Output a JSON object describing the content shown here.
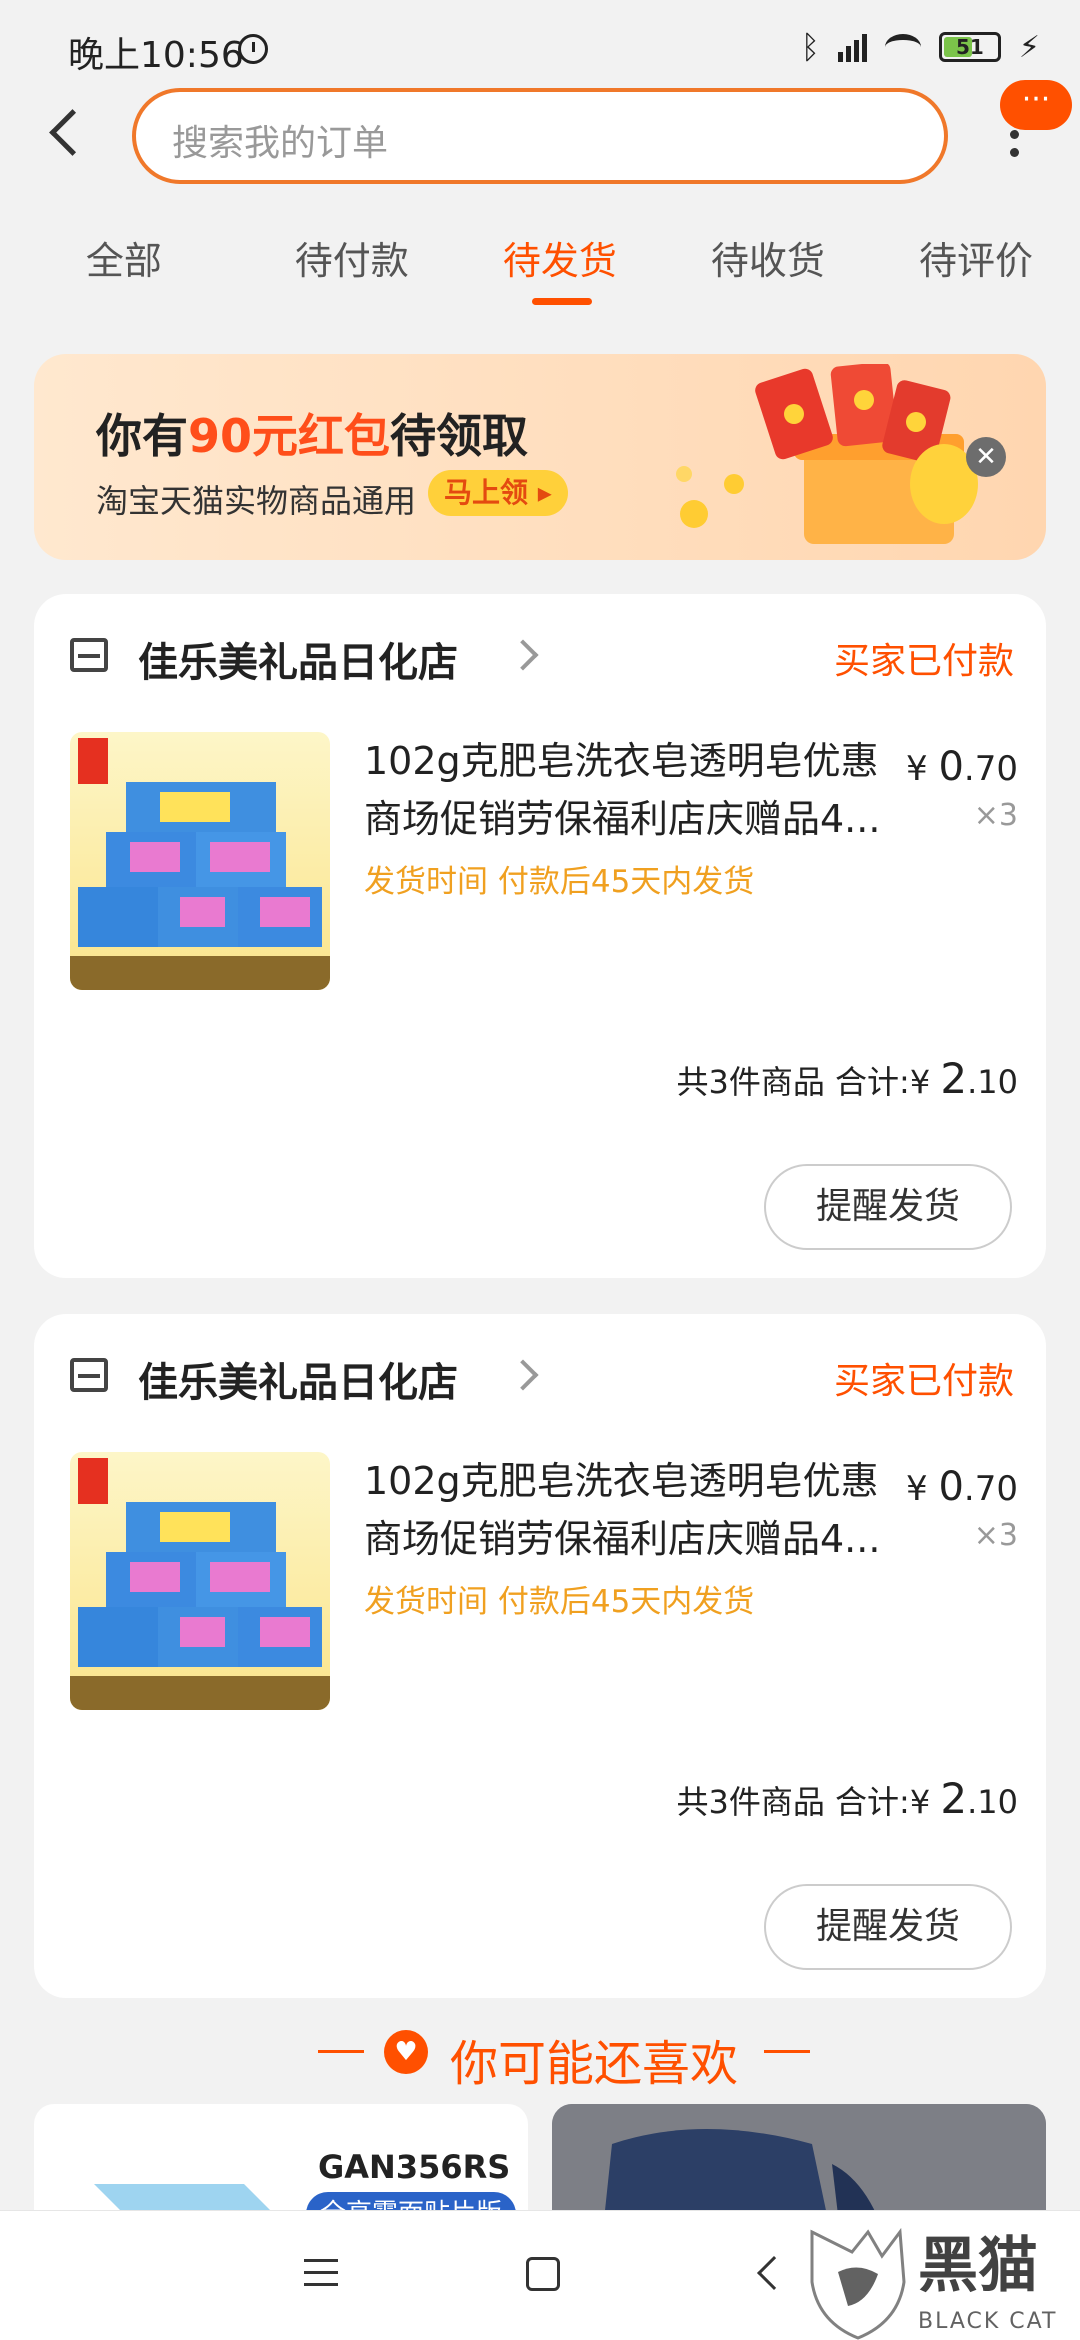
{
  "status_bar": {
    "time": "晚上10:56",
    "battery": "51",
    "bluetooth_icon": "bluetooth-icon",
    "signal_icon": "signal-icon",
    "wifi_icon": "wifi-icon"
  },
  "header": {
    "search_placeholder": "搜索我的订单",
    "more_badge": "···"
  },
  "tabs": [
    {
      "label": "全部",
      "active": false
    },
    {
      "label": "待付款",
      "active": false
    },
    {
      "label": "待发货",
      "active": true
    },
    {
      "label": "待收货",
      "active": false
    },
    {
      "label": "待评价",
      "active": false
    }
  ],
  "promo": {
    "title_prefix": "你有",
    "title_highlight": "90元红包",
    "title_suffix": "待领取",
    "subtitle": "淘宝天猫实物商品通用",
    "button": "马上领 ▸",
    "close": "✕"
  },
  "orders": [
    {
      "shop_name": "佳乐美礼品日化店",
      "status": "买家已付款",
      "product_title": "102g克肥皂洗衣皂透明皂优惠商场促销劳保福利店庆赠品4...",
      "ship_note": "发货时间  付款后45天内发货",
      "price_symbol": "¥",
      "price_int": "0",
      "price_dec": ".70",
      "qty": "×3",
      "total_label": "共3件商品  合计:",
      "total_symbol": "¥",
      "total_int": "2",
      "total_dec": ".10",
      "button": "提醒发货"
    },
    {
      "shop_name": "佳乐美礼品日化店",
      "status": "买家已付款",
      "product_title": "102g克肥皂洗衣皂透明皂优惠商场促销劳保福利店庆赠品4...",
      "ship_note": "发货时间  付款后45天内发货",
      "price_symbol": "¥",
      "price_int": "0",
      "price_dec": ".70",
      "qty": "×3",
      "total_label": "共3件商品  合计:",
      "total_symbol": "¥",
      "total_int": "2",
      "total_dec": ".10",
      "button": "提醒发货"
    }
  ],
  "recommend": {
    "heading": "你可能还喜欢",
    "card_left_brand": "GAN356RS",
    "card_left_tag": "全高雾面贴片版"
  },
  "watermark": {
    "text": "黑猫",
    "sub": "BLACK CAT"
  },
  "colors": {
    "accent": "#ff5000",
    "ship_note": "#f0a020"
  }
}
